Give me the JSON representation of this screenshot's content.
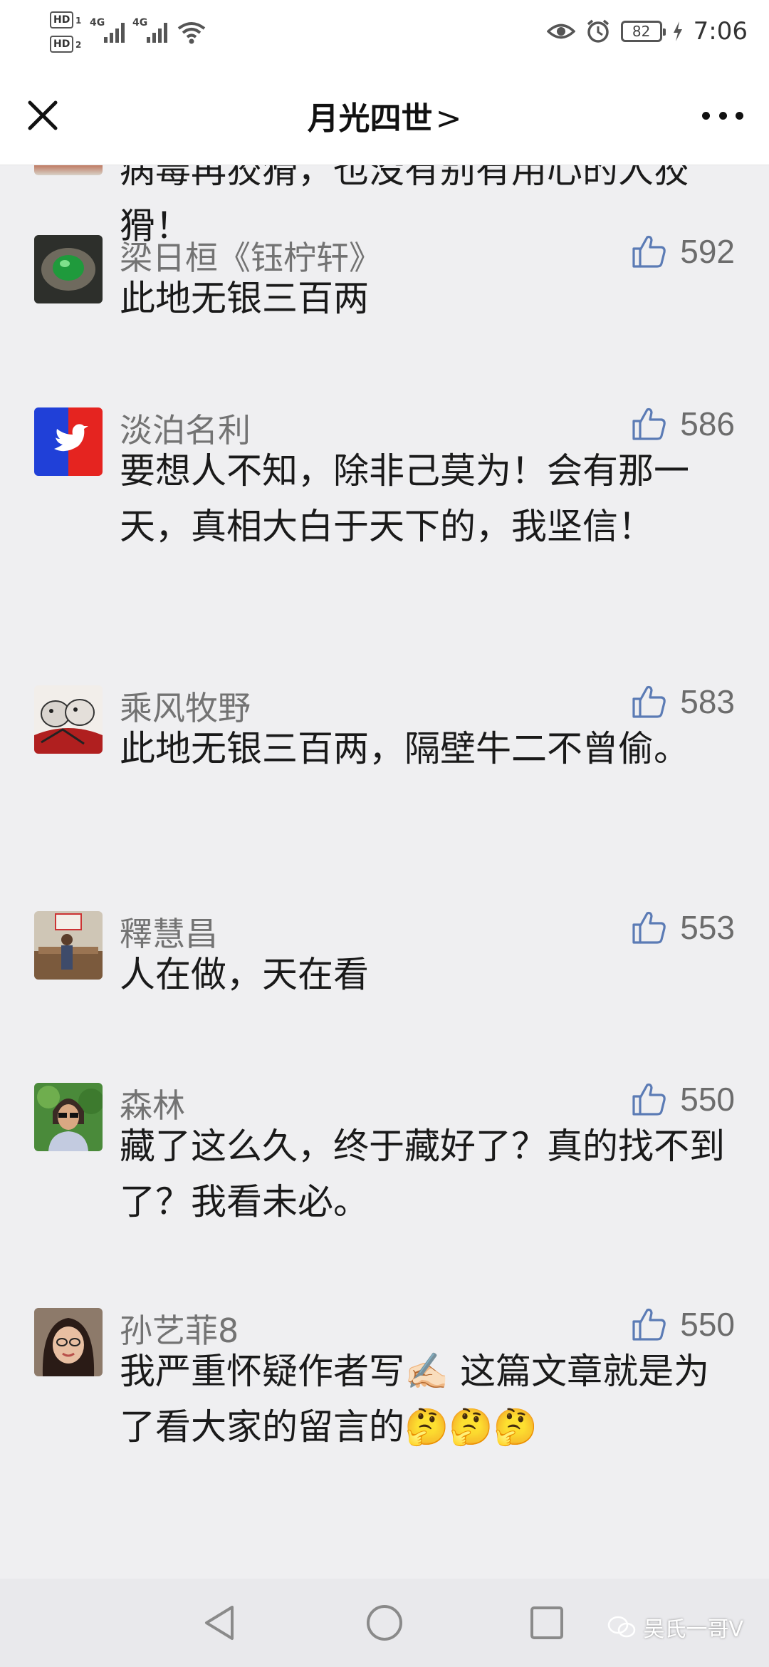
{
  "status_bar": {
    "hd1": "HD",
    "hd1_sub": "1",
    "hd2": "HD",
    "hd2_sub": "2",
    "net1": "4G",
    "net2": "4G",
    "battery": "82",
    "time": "7:06"
  },
  "header": {
    "title": "月光四世",
    "chevron": ">",
    "close_icon": "close-icon",
    "more_icon": "more-icon"
  },
  "comments": [
    {
      "name": "",
      "text": "病毒再狡猾，也没有别有用心的人狡猾！",
      "likes": ""
    },
    {
      "name": "梁日桓《钰柠轩》",
      "text": "此地无银三百两",
      "likes": "592"
    },
    {
      "name": "淡泊名利",
      "text": "要想人不知，除非己莫为！会有那一天，真相大白于天下的，我坚信！",
      "likes": "586"
    },
    {
      "name": "乘风牧野",
      "text": "此地无银三百两，隔壁牛二不曾偷。",
      "likes": "583"
    },
    {
      "name": "釋慧昌",
      "text": "人在做，天在看",
      "likes": "553"
    },
    {
      "name": "森林",
      "text": "藏了这么久，终于藏好了？真的找不到了？我看未必。",
      "likes": "550"
    },
    {
      "name": "孙艺菲8",
      "text": "我严重怀疑作者写✍🏻 这篇文章就是为了看大家的留言的🤔🤔🤔",
      "likes": "550"
    }
  ],
  "nav": {
    "back_icon": "back-triangle-icon",
    "home_icon": "home-circle-icon",
    "recent_icon": "recent-square-icon"
  },
  "watermark": {
    "text": "吴氏一哥V"
  },
  "colors": {
    "accent_like": "#5b7bb5",
    "name_gray": "#737373"
  }
}
